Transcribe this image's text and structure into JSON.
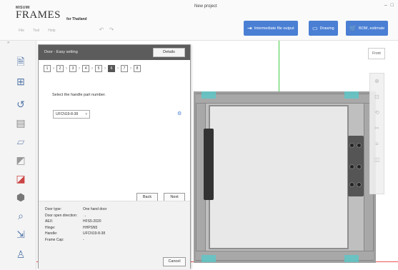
{
  "app": {
    "brand_small": "MISUMI",
    "brand": "FRAMES",
    "brand_sub": "for Thailand",
    "window_title": "New project",
    "menu": [
      "File",
      "Tool",
      "Help"
    ],
    "window_controls": [
      "–",
      "□"
    ]
  },
  "toolbar": {
    "intermediate_label": "Intermediate file output",
    "drawing_label": "Drawing",
    "bom_label": "BOM, estimate"
  },
  "canvas": {
    "front_label": "Front"
  },
  "dialog": {
    "title": "Door - Easy setting",
    "details_label": "Details",
    "steps": [
      "1",
      "2",
      "3",
      "4",
      "5",
      "6",
      "7",
      "8"
    ],
    "active_step": "6",
    "prompt": "Select the handle part number.",
    "part_number": "UFCN19-8-38",
    "back_label": "Back",
    "next_label": "Next",
    "cancel_label": "Cancel",
    "info": [
      {
        "key": "Door type:",
        "value": "One hand door"
      },
      {
        "key": "Door open direction:",
        "value": "→"
      },
      {
        "key": "AEX:",
        "value": "HFS5-2020"
      },
      {
        "key": "Hinge:",
        "value": "HHPSN5"
      },
      {
        "key": "Handle:",
        "value": "UFCN19-8-38"
      },
      {
        "key": "Frame Cap:",
        "value": "-"
      }
    ]
  },
  "colors": {
    "accent": "#4a7fd4",
    "dialog_header": "#5c5c5c",
    "axis_green": "#44cc44",
    "axis_red": "#ee5555",
    "highlight_teal": "#5fc7c7"
  }
}
